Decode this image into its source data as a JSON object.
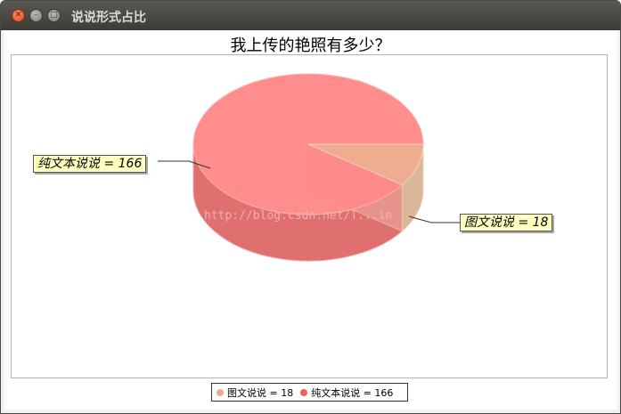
{
  "window": {
    "title": "说说形式占比"
  },
  "watermark": "http://blog.csdn.net/T...in",
  "chart_data": {
    "type": "pie",
    "style": "3d",
    "title": "我上传的艳照有多少？",
    "slices": [
      {
        "name": "图文说说",
        "value": 18,
        "color": "#eea98a",
        "label": "图文说说 = 18"
      },
      {
        "name": "纯文本说说",
        "value": 166,
        "color": "#ff8080",
        "label": "纯文本说说 = 166"
      }
    ],
    "legend": {
      "position": "bottom",
      "items": [
        {
          "label": "图文说说 = 18",
          "color": "#eea98a"
        },
        {
          "label": "纯文本说说 = 166",
          "color": "#f06050"
        }
      ]
    }
  }
}
